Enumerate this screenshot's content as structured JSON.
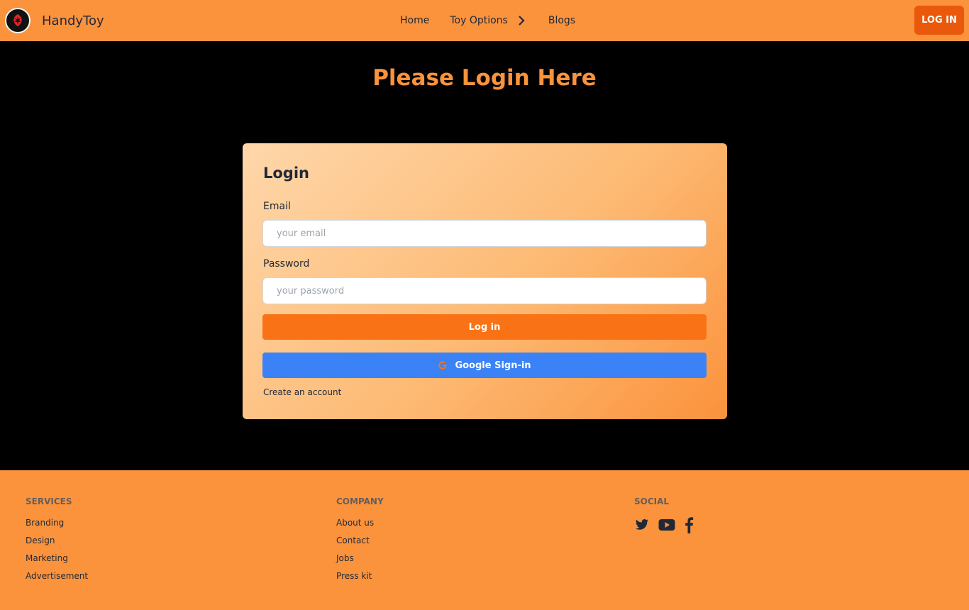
{
  "navbar": {
    "brand": "HandyToy",
    "links": {
      "home": "Home",
      "toy_options": "Toy Options",
      "blogs": "Blogs"
    },
    "login_button": "LOG IN"
  },
  "page": {
    "heading": "Please Login Here"
  },
  "login_form": {
    "title": "Login",
    "email_label": "Email",
    "email_placeholder": "your email",
    "email_value": "",
    "password_label": "Password",
    "password_placeholder": "your password",
    "password_value": "",
    "login_button": "Log in",
    "google_button": "Google Sign-in",
    "create_account": "Create an account"
  },
  "footer": {
    "services": {
      "heading": "SERVICES",
      "links": [
        "Branding",
        "Design",
        "Marketing",
        "Advertisement"
      ]
    },
    "company": {
      "heading": "COMPANY",
      "links": [
        "About us",
        "Contact",
        "Jobs",
        "Press kit"
      ]
    },
    "social": {
      "heading": "SOCIAL",
      "icons": [
        "twitter-icon",
        "youtube-icon",
        "facebook-icon"
      ]
    }
  },
  "colors": {
    "accent": "#fb923c",
    "primary_button": "#f97316",
    "nav_login_button": "#ea580c",
    "google_button": "#3b82f6",
    "background": "#000000"
  }
}
